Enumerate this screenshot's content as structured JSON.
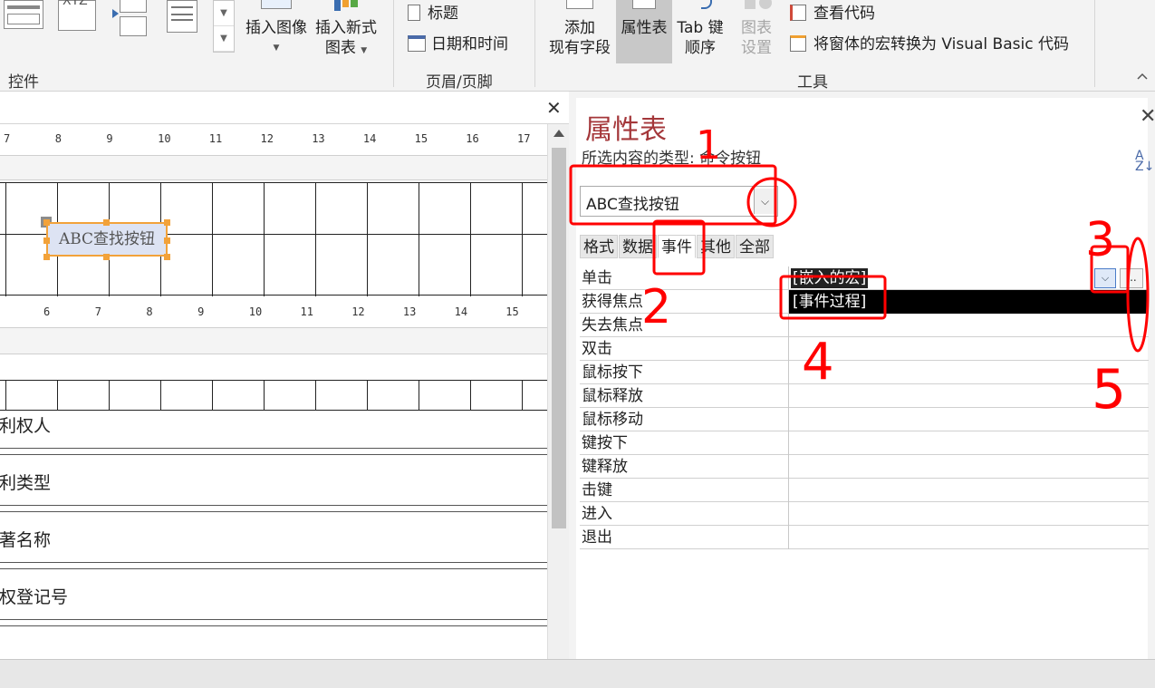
{
  "ribbon": {
    "controls_group_label": "控件",
    "insert_image_label": "插入图像",
    "insert_chart_label_line1": "插入新式",
    "insert_chart_label_line2": "图表",
    "headerfooter_title_label": "标题",
    "headerfooter_datetime_label": "日期和时间",
    "headerfooter_group_label": "页眉/页脚",
    "add_field_line1": "添加",
    "add_field_line2": "现有字段",
    "property_sheet_label": "属性表",
    "tab_order_line1": "Tab 键",
    "tab_order_line2": "顺序",
    "chart_settings_line1": "图表",
    "chart_settings_line2": "设置",
    "view_code_label": "查看代码",
    "convert_macros_label": "将窗体的宏转换为 Visual Basic 代码",
    "tools_group_label": "工具",
    "gallery_top_text": "XYZ"
  },
  "design": {
    "ruler_top": [
      "7",
      "8",
      "9",
      "10",
      "11",
      "12",
      "13",
      "14",
      "15",
      "16",
      "17"
    ],
    "ruler_mid": [
      "6",
      "7",
      "8",
      "9",
      "10",
      "11",
      "12",
      "13",
      "14",
      "15"
    ],
    "command_button_label": "ABC查找按钮",
    "fields": [
      "专利权人",
      "专利类型",
      "论著名称",
      "版权登记号"
    ]
  },
  "property_sheet": {
    "title": "属性表",
    "selection_type": "所选内容的类型: 命令按钮",
    "selected_object": "ABC查找按钮",
    "tabs": [
      "格式",
      "数据",
      "事件",
      "其他",
      "全部"
    ],
    "active_tab": "事件",
    "rows": [
      {
        "name": "单击",
        "value": "[嵌入的宏]"
      },
      {
        "name": "获得焦点",
        "value": ""
      },
      {
        "name": "失去焦点",
        "value": ""
      },
      {
        "name": "双击",
        "value": ""
      },
      {
        "name": "鼠标按下",
        "value": ""
      },
      {
        "name": "鼠标释放",
        "value": ""
      },
      {
        "name": "鼠标移动",
        "value": ""
      },
      {
        "name": "键按下",
        "value": ""
      },
      {
        "name": "键释放",
        "value": ""
      },
      {
        "name": "击键",
        "value": ""
      },
      {
        "name": "进入",
        "value": ""
      },
      {
        "name": "退出",
        "value": ""
      }
    ],
    "dropdown_option": "[事件过程]",
    "build_button_label": "..."
  },
  "annotations": {
    "color": "#ff0000",
    "labels": [
      "1",
      "2",
      "3",
      "4",
      "5"
    ]
  }
}
